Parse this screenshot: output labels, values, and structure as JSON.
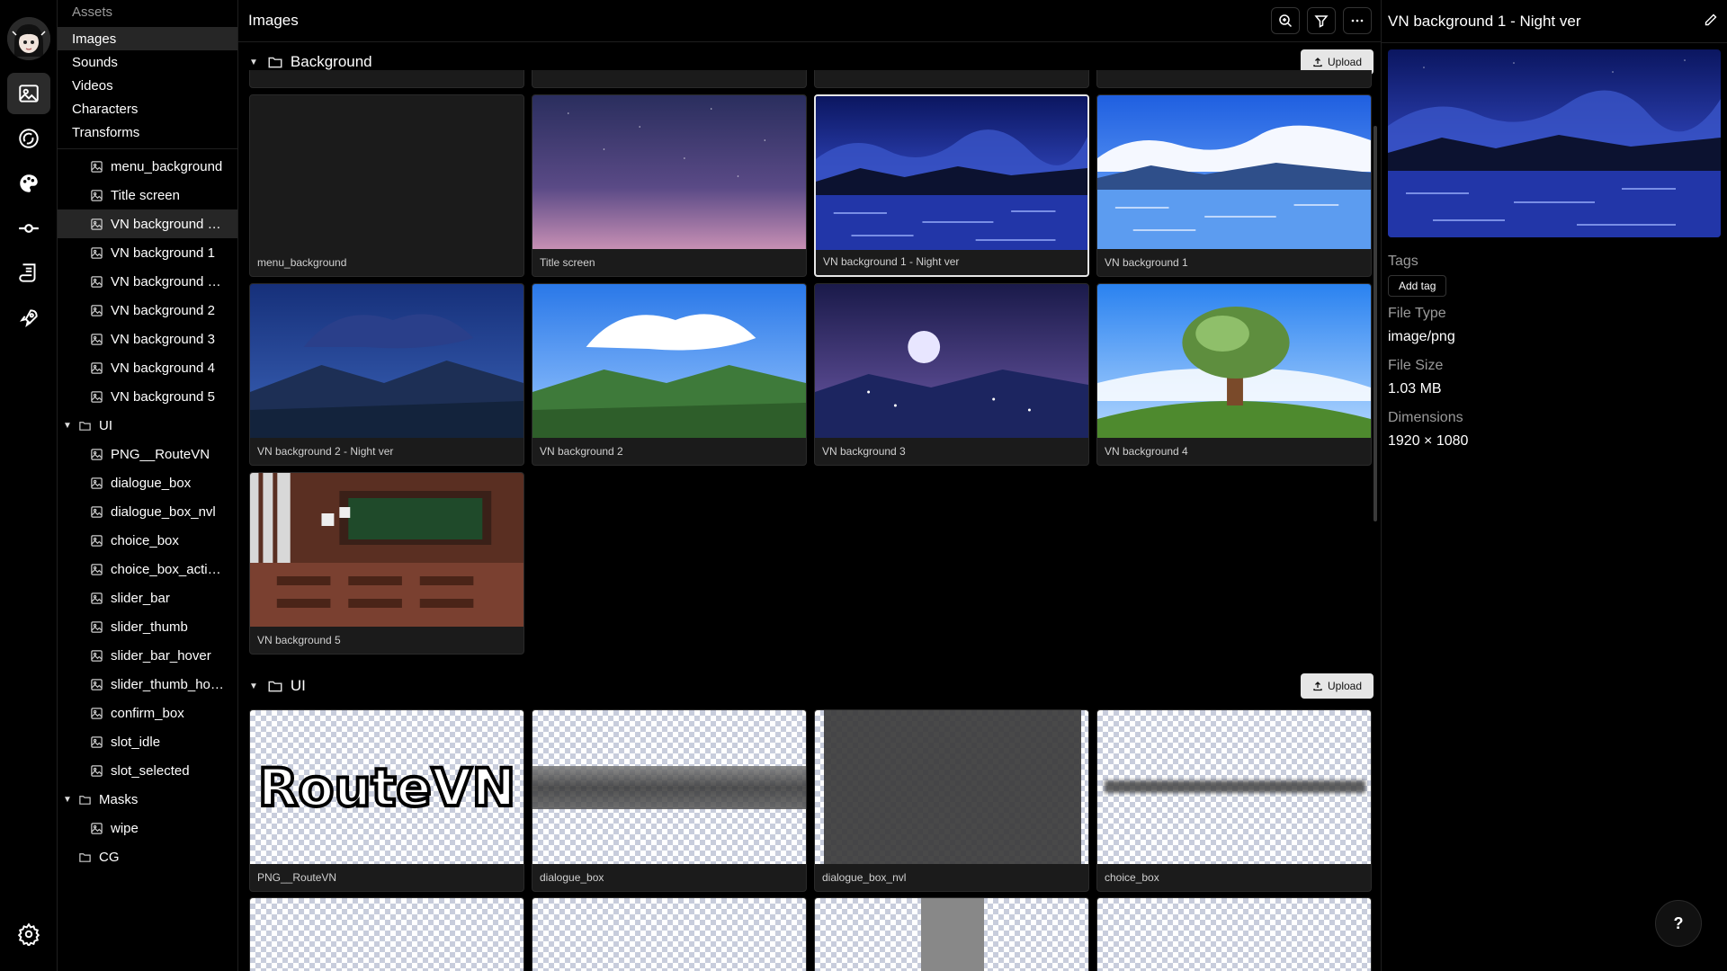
{
  "rail": {
    "icons": [
      "avatar",
      "image-icon",
      "sound-icon",
      "palette-icon",
      "commit-icon",
      "script-icon",
      "rocket-icon",
      "settings-icon"
    ]
  },
  "sidebar": {
    "section_label": "Assets",
    "nav": [
      {
        "label": "Images",
        "active": true
      },
      {
        "label": "Sounds"
      },
      {
        "label": "Videos"
      },
      {
        "label": "Characters"
      },
      {
        "label": "Transforms"
      }
    ],
    "tree": {
      "background_files": [
        "menu_background",
        "Title screen",
        "VN background 1 - ...",
        "VN background 1",
        "VN background 2 - ...",
        "VN background 2",
        "VN background 3",
        "VN background 4",
        "VN background 5"
      ],
      "ui_folder": "UI",
      "ui_files": [
        "PNG__RouteVN",
        "dialogue_box",
        "dialogue_box_nvl",
        "choice_box",
        "choice_box_activat...",
        "slider_bar",
        "slider_thumb",
        "slider_bar_hover",
        "slider_thumb_hover",
        "confirm_box",
        "slot_idle",
        "slot_selected"
      ],
      "masks_folder": "Masks",
      "masks_files": [
        "wipe"
      ],
      "cg_folder": "CG"
    }
  },
  "main": {
    "title": "Images",
    "groups": {
      "background": {
        "name": "Background",
        "upload_label": "Upload",
        "cards": [
          "menu_background",
          "Title screen",
          "VN background 1 - Night ver",
          "VN background 1",
          "VN background 2 - Night ver",
          "VN background 2",
          "VN background 3",
          "VN background 4",
          "VN background 5"
        ]
      },
      "ui": {
        "name": "UI",
        "upload_label": "Upload",
        "cards": [
          "PNG__RouteVN",
          "dialogue_box",
          "dialogue_box_nvl",
          "choice_box"
        ],
        "logo_text": "RouteVN"
      }
    }
  },
  "detail": {
    "title": "VN background 1 - Night ver",
    "tags_label": "Tags",
    "add_tag_label": "Add tag",
    "file_type_label": "File Type",
    "file_type": "image/png",
    "file_size_label": "File Size",
    "file_size": "1.03 MB",
    "dimensions_label": "Dimensions",
    "dimensions": "1920 × 1080"
  },
  "help_label": "?",
  "colors": {
    "accent": "#e6e6e6",
    "panel": "#1b1b1b",
    "background": "#000000"
  }
}
